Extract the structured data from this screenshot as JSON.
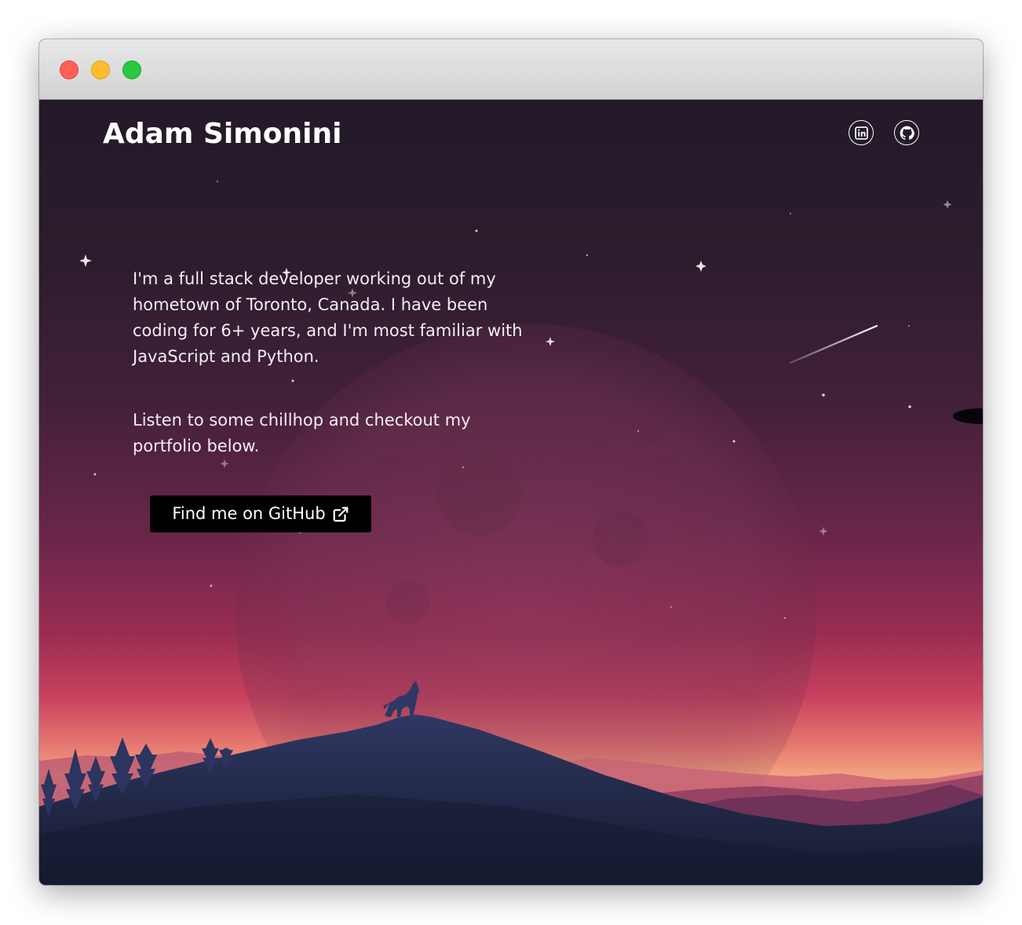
{
  "site": {
    "title": "Adam Simonini"
  },
  "social": [
    {
      "icon": "linkedin-icon"
    },
    {
      "icon": "github-icon"
    }
  ],
  "intro": {
    "paragraph1": "I'm a full stack developer working out of my hometown of Toronto, Canada. I have been coding for 6+ years, and I'm most familiar with JavaScript and Python.",
    "paragraph2": "Listen to some chillhop and checkout my portfolio below."
  },
  "cta": {
    "label": "Find me on GitHub",
    "icon": "external-link-icon"
  },
  "colors": {
    "sky_top": "#241a28",
    "sky_mid": "#5e2444",
    "sky_glow": "#e05a6a",
    "horizon": "#f3a07a",
    "mountain": "#262c4e",
    "button": "#000000",
    "text": "#ffffff"
  }
}
